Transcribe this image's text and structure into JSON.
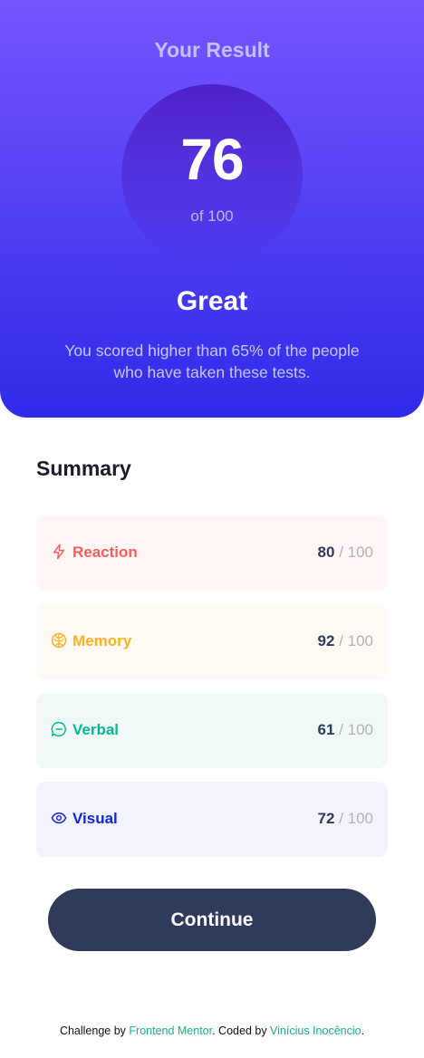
{
  "result": {
    "title": "Your Result",
    "score": "76",
    "out_of": "of 100",
    "verdict": "Great",
    "description": "You scored higher than 65% of the people who have taken these tests."
  },
  "summary": {
    "title": "Summary",
    "categories": [
      {
        "label": "Reaction",
        "score": "80",
        "total": "/ 100",
        "icon": "lightning-icon",
        "color": "#f55d5d",
        "bg": "#fff6f5"
      },
      {
        "label": "Memory",
        "score": "92",
        "total": "/ 100",
        "icon": "brain-icon",
        "color": "#ffb01f",
        "bg": "#fffaf3"
      },
      {
        "label": "Verbal",
        "score": "61",
        "total": "/ 100",
        "icon": "chat-bubble-icon",
        "color": "#00bb8f",
        "bg": "#f1f9f8"
      },
      {
        "label": "Visual",
        "score": "72",
        "total": "/ 100",
        "icon": "eye-icon",
        "color": "#1125d6",
        "bg": "#f3f3fd"
      }
    ]
  },
  "button": {
    "continue_label": "Continue"
  },
  "attribution": {
    "challenge_prefix": "Challenge by ",
    "challenge_link": "Frontend Mentor",
    "coded_prefix": ". Coded by ",
    "author_link": "Vinícius Inocêncio",
    "suffix": "."
  },
  "colors": {
    "gradient_top": "#7755ff",
    "gradient_bottom": "#2f2be9",
    "button_bg": "#303b5a",
    "link": "#17b28a"
  }
}
